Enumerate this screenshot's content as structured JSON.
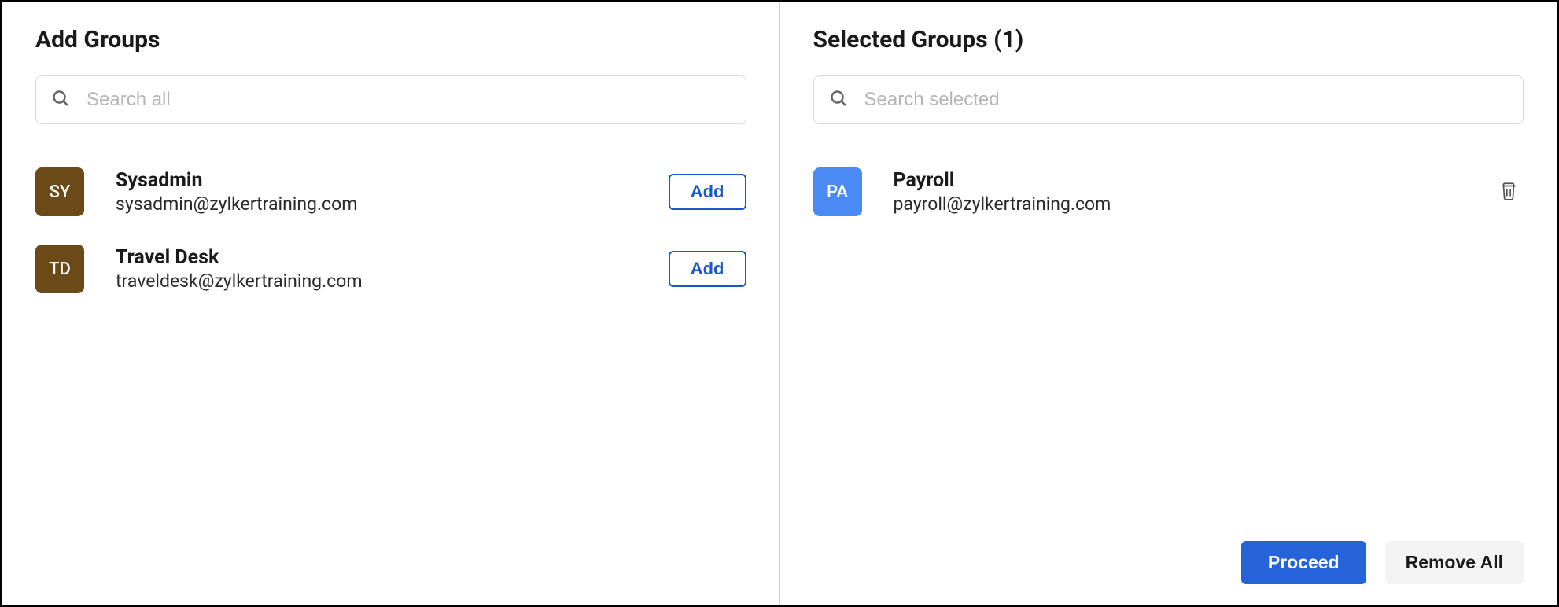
{
  "left": {
    "title": "Add Groups",
    "search_placeholder": "Search all",
    "add_label": "Add",
    "groups": [
      {
        "initials": "SY",
        "name": "Sysadmin",
        "email": "sysadmin@zylkertraining.com",
        "color": "brown"
      },
      {
        "initials": "TD",
        "name": "Travel Desk",
        "email": "traveldesk@zylkertraining.com",
        "color": "brown"
      }
    ]
  },
  "right": {
    "title": "Selected Groups (1)",
    "search_placeholder": "Search selected",
    "groups": [
      {
        "initials": "PA",
        "name": "Payroll",
        "email": "payroll@zylkertraining.com",
        "color": "blue"
      }
    ],
    "proceed_label": "Proceed",
    "remove_all_label": "Remove All"
  }
}
